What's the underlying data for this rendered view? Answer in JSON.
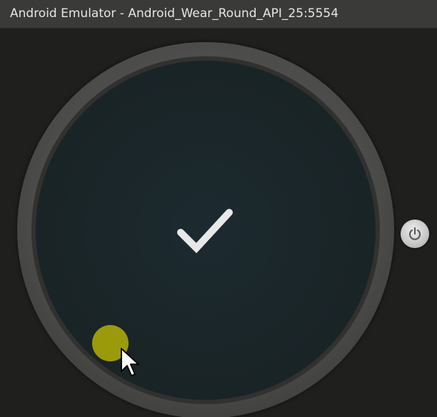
{
  "window": {
    "title": "Android Emulator - Android_Wear_Round_API_25:5554"
  },
  "watch": {
    "screen_icon": "checkmark-icon",
    "touch_indicator_color": "#9a9a0a",
    "pointer": "mouse-cursor-icon"
  },
  "controls": {
    "power_icon": "power-icon"
  },
  "colors": {
    "titlebar": "#3a3a39",
    "title_text": "#e6e6e6",
    "background": "#1f1f1e",
    "bezel": "#4c4c4b",
    "screen": "#1a2528",
    "checkmark": "#e8e8e8"
  }
}
